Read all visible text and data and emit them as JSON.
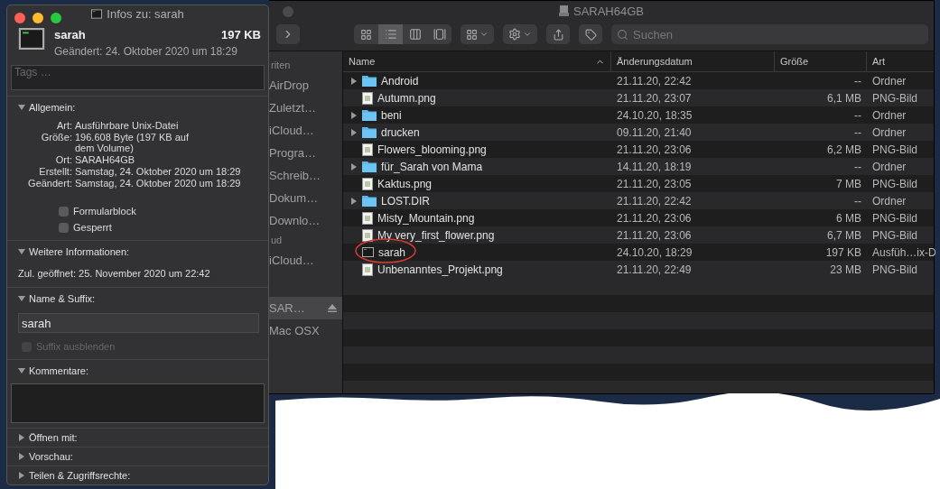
{
  "finder": {
    "title": "SARAH64GB",
    "search": {
      "placeholder": "Suchen"
    },
    "view_modes": [
      {
        "kind": "icons",
        "selected": false
      },
      {
        "kind": "list",
        "selected": true
      },
      {
        "kind": "columns",
        "selected": false
      },
      {
        "kind": "gallery",
        "selected": false
      }
    ],
    "sidebar": [
      {
        "kind": "header",
        "label": "riten"
      },
      {
        "kind": "item",
        "label": "AirDrop",
        "selected": false
      },
      {
        "kind": "item",
        "label": "Zuletzt…",
        "selected": false
      },
      {
        "kind": "item",
        "label": "iCloud…",
        "selected": false
      },
      {
        "kind": "item",
        "label": "Progra…",
        "selected": false
      },
      {
        "kind": "item",
        "label": "Schreib…",
        "selected": false
      },
      {
        "kind": "item",
        "label": "Dokum…",
        "selected": false
      },
      {
        "kind": "item",
        "label": "Downlo…",
        "selected": false
      },
      {
        "kind": "header",
        "label": "ud"
      },
      {
        "kind": "item",
        "label": "iCloud…",
        "selected": false
      },
      {
        "kind": "gap"
      },
      {
        "kind": "volume",
        "label": "SAR…",
        "selected": true
      },
      {
        "kind": "item",
        "label": "Mac OSX",
        "selected": false
      }
    ],
    "columns": [
      {
        "label": "Name",
        "sorted": true
      },
      {
        "label": "Änderungsdatum",
        "sorted": false
      },
      {
        "label": "Größe",
        "sorted": false
      },
      {
        "label": "Art",
        "sorted": false
      }
    ],
    "rows": [
      {
        "kind": "folder",
        "name": "Android",
        "date": "21.11.20, 22:42",
        "size": "--",
        "type": "Ordner",
        "circled": false
      },
      {
        "kind": "image",
        "name": "Autumn.png",
        "date": "21.11.20, 23:07",
        "size": "6,1 MB",
        "type": "PNG-Bild",
        "circled": false
      },
      {
        "kind": "folder",
        "name": "beni",
        "date": "24.10.20, 18:35",
        "size": "--",
        "type": "Ordner",
        "circled": false
      },
      {
        "kind": "folder",
        "name": "drucken",
        "date": "09.11.20, 21:40",
        "size": "--",
        "type": "Ordner",
        "circled": false
      },
      {
        "kind": "image",
        "name": "Flowers_blooming.png",
        "date": "21.11.20, 23:06",
        "size": "6,2 MB",
        "type": "PNG-Bild",
        "circled": false
      },
      {
        "kind": "folder",
        "name": "für_Sarah von Mama",
        "date": "14.11.20, 18:19",
        "size": "--",
        "type": "Ordner",
        "circled": false
      },
      {
        "kind": "image",
        "name": "Kaktus.png",
        "date": "21.11.20, 23:05",
        "size": "7 MB",
        "type": "PNG-Bild",
        "circled": false
      },
      {
        "kind": "folder",
        "name": "LOST.DIR",
        "date": "21.11.20, 22:42",
        "size": "--",
        "type": "Ordner",
        "circled": false
      },
      {
        "kind": "image",
        "name": "Misty_Mountain.png",
        "date": "21.11.20, 23:06",
        "size": "6 MB",
        "type": "PNG-Bild",
        "circled": false
      },
      {
        "kind": "image",
        "name": "My very_first_flower.png",
        "date": "21.11.20, 23:06",
        "size": "6,7 MB",
        "type": "PNG-Bild",
        "circled": false
      },
      {
        "kind": "executable",
        "name": "sarah",
        "date": "24.10.20, 18:29",
        "size": "197 KB",
        "type": "Ausfüh…ix-D",
        "circled": true
      },
      {
        "kind": "image",
        "name": "Unbenanntes_Projekt.png",
        "date": "21.11.20, 22:49",
        "size": "23 MB",
        "type": "PNG-Bild",
        "circled": false
      }
    ]
  },
  "info_window": {
    "title": "Infos zu: sarah",
    "file_name": "sarah",
    "file_size": "197 KB",
    "modified": "Geändert: 24. Oktober 2020 um 18:29",
    "tags": {
      "placeholder": "Tags …"
    },
    "sections": [
      {
        "kind": "details",
        "title": "Allgemein:",
        "expanded": true,
        "rows": [
          {
            "label": "Art:",
            "value": "Ausführbare Unix-Datei"
          },
          {
            "label": "Größe:",
            "value": "196.608 Byte (197 KB auf dem Volume)"
          },
          {
            "label": "Ort:",
            "value": "SARAH64GB"
          },
          {
            "label": "Erstellt:",
            "value": "Samstag, 24. Oktober 2020 um 18:29"
          },
          {
            "label": "Geändert:",
            "value": "Samstag, 24. Oktober 2020 um 18:29"
          }
        ],
        "checkboxes": [
          {
            "label": "Formularblock",
            "checked": false,
            "disabled": false
          },
          {
            "label": "Gesperrt",
            "checked": false,
            "disabled": false
          }
        ]
      },
      {
        "kind": "text",
        "title": "Weitere Informationen:",
        "expanded": true,
        "text": "Zul. geöffnet: 25. November 2020 um 22:42"
      },
      {
        "kind": "name",
        "title": "Name & Suffix:",
        "expanded": true,
        "value": "sarah",
        "checkbox": {
          "label": "Suffix ausblenden",
          "checked": false,
          "disabled": true
        }
      },
      {
        "kind": "comments",
        "title": "Kommentare:",
        "expanded": true
      },
      {
        "title": "Öffnen mit:",
        "expanded": false
      },
      {
        "title": "Vorschau:",
        "expanded": false
      },
      {
        "title": "Teilen & Zugriffsrechte:",
        "expanded": false
      }
    ]
  }
}
